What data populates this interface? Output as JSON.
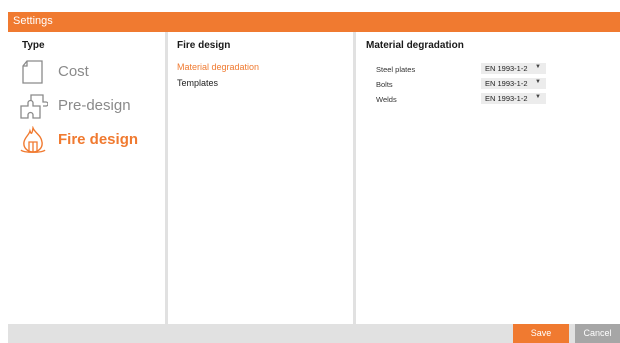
{
  "window": {
    "title": "Settings"
  },
  "type_panel": {
    "header": "Type",
    "items": [
      {
        "label": "Cost",
        "icon": "document-icon",
        "active": false
      },
      {
        "label": "Pre-design",
        "icon": "puzzle-icon",
        "active": false
      },
      {
        "label": "Fire design",
        "icon": "fire-icon",
        "active": true
      }
    ]
  },
  "nav_panel": {
    "header": "Fire design",
    "items": [
      {
        "label": "Material degradation",
        "active": true
      },
      {
        "label": "Templates",
        "active": false
      }
    ]
  },
  "detail_panel": {
    "header": "Material degradation",
    "rows": [
      {
        "label": "Steel plates",
        "value": "EN 1993-1-2"
      },
      {
        "label": "Bolts",
        "value": "EN 1993-1-2"
      },
      {
        "label": "Welds",
        "value": "EN 1993-1-2"
      }
    ]
  },
  "footer": {
    "save_label": "Save",
    "cancel_label": "Cancel"
  },
  "colors": {
    "accent": "#f07a30",
    "inactive": "#8a8a8a",
    "separator": "#e1e1e1",
    "cancel": "#a6a6a6"
  }
}
